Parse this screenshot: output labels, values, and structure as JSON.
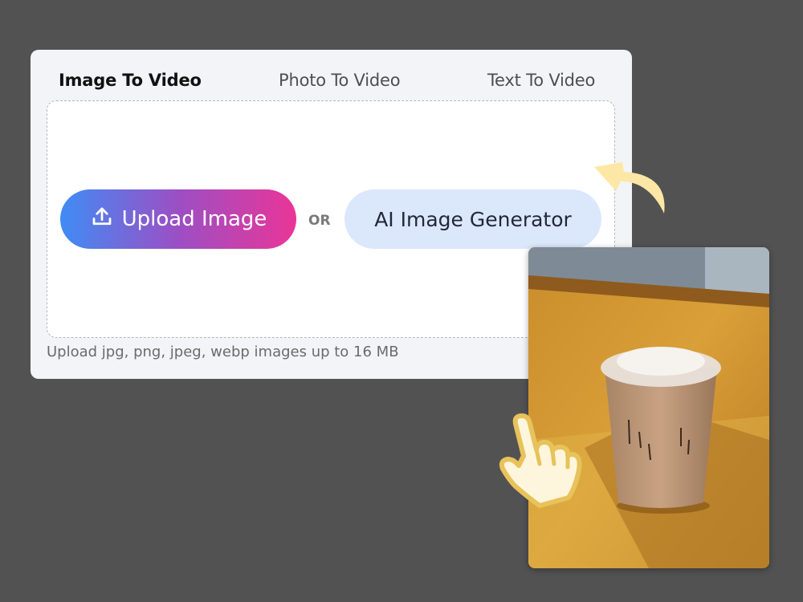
{
  "tabs": [
    {
      "label": "Image To Video",
      "active": true
    },
    {
      "label": "Photo To Video",
      "active": false
    },
    {
      "label": "Text To Video",
      "active": false
    }
  ],
  "upload": {
    "label": "Upload Image",
    "icon": "upload-icon"
  },
  "or_label": "OR",
  "ai_generator": {
    "label": "AI Image Generator"
  },
  "hint": "Upload jpg, png, jpeg, webp images up to 16 MB",
  "colors": {
    "background": "#525252",
    "card": "#f3f4f8",
    "upload_gradient": [
      "#3f8cf5",
      "#9c4fc4",
      "#ea3597"
    ],
    "ai_button": "#dbe7fb",
    "accent_yellow": "#fde7a6"
  },
  "decorations": {
    "arrow_icon": "curved-arrow-icon",
    "hand_icon": "pointing-hand-icon",
    "photo": "iced-coffee-photo"
  }
}
